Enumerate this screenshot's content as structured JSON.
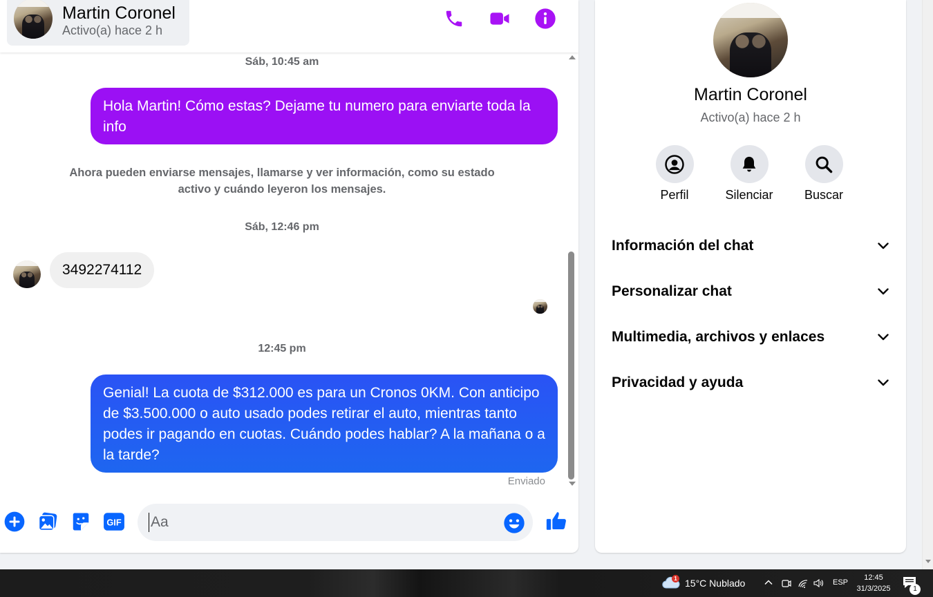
{
  "header": {
    "name": "Martin Coronel",
    "status": "Activo(a) hace 2 h",
    "accent_color": "#9b10f4",
    "icons": [
      "phone-icon",
      "video-camera-icon",
      "info-icon"
    ]
  },
  "messages": {
    "timestamp_1": "Sáb, 10:45 am",
    "outgoing_1": "Hola Martin! Cómo estas? Dejame tu numero para enviarte toda la info",
    "system_note": "Ahora pueden enviarse mensajes, llamarse y ver información, como su estado activo y cuándo leyeron los mensajes.",
    "timestamp_2": "Sáb, 12:46 pm",
    "incoming_1": "3492274112",
    "timestamp_3": "12:45 pm",
    "outgoing_2": "Genial! La cuota de $312.000 es para un Cronos 0KM. Con anticipo de $3.500.000 o auto usado podes retirar el auto, mientras tanto podes ir pagando en cuotas. Cuándo podes hablar? A la mañana o a la tarde?",
    "sent_status": "Enviado",
    "bubble_colors": {
      "outgoing_1": "#9b10f4",
      "outgoing_2": "#1f5df3",
      "incoming": "#f0f0f0"
    }
  },
  "composer": {
    "placeholder": "Aa",
    "value": "",
    "icons": [
      "plus-icon",
      "image-icon",
      "sticker-icon",
      "gif-icon",
      "emoji-icon",
      "thumbs-up-icon"
    ],
    "gif_label": "GIF",
    "icon_color": "#0866ff"
  },
  "info_panel": {
    "name": "Martin Coronel",
    "status": "Activo(a) hace 2 h",
    "actions": [
      {
        "label": "Perfil",
        "icon": "profile-icon"
      },
      {
        "label": "Silenciar",
        "icon": "bell-icon"
      },
      {
        "label": "Buscar",
        "icon": "search-icon"
      }
    ],
    "sections": [
      {
        "label": "Información del chat"
      },
      {
        "label": "Personalizar chat"
      },
      {
        "label": "Multimedia, archivos y enlaces"
      },
      {
        "label": "Privacidad y ayuda"
      }
    ]
  },
  "taskbar": {
    "weather_text": "15°C  Nublado",
    "weather_badge": "1",
    "language": "ESP",
    "time": "12:45",
    "date": "31/3/2025",
    "notification_count": "1"
  }
}
